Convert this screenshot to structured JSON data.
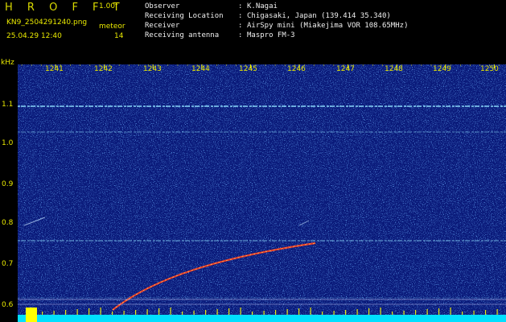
{
  "header": {
    "logo": "H R O F F T",
    "version": "1.00f",
    "filename": "KN9_2504291240.png",
    "datetime": "25.04.29 12:40",
    "meteor_label": "meteor",
    "meteor_count": "14"
  },
  "info": {
    "rows": [
      {
        "label": "Observer",
        "sep": ":",
        "value": "K.Nagai"
      },
      {
        "label": "Receiving Location",
        "sep": ":",
        "value": "Chigasaki, Japan (139.414 35.340)"
      },
      {
        "label": "Receiver",
        "sep": ":",
        "value": "AirSpy mini (Miakejima VOR 108.65MHz)"
      },
      {
        "label": "Receiving antenna",
        "sep": ":",
        "value": "Maspro FM-3"
      }
    ]
  },
  "chart_data": {
    "type": "heatmap",
    "ylabel": "kHz",
    "x_ticks": [
      "1241",
      "1242",
      "1243",
      "1244",
      "1245",
      "1246",
      "1247",
      "1248",
      "1249",
      "1250"
    ],
    "y_ticks": [
      "1.1",
      "1.0",
      "0.9",
      "0.8",
      "0.7",
      "0.6"
    ],
    "ylim": [
      0.57,
      1.2
    ],
    "colors": {
      "background": "#0a1a7a",
      "carrier": "#8fe0ff",
      "trace": "#ff4020",
      "baseline": "#00e0ff",
      "tick": "#ffff00"
    }
  }
}
